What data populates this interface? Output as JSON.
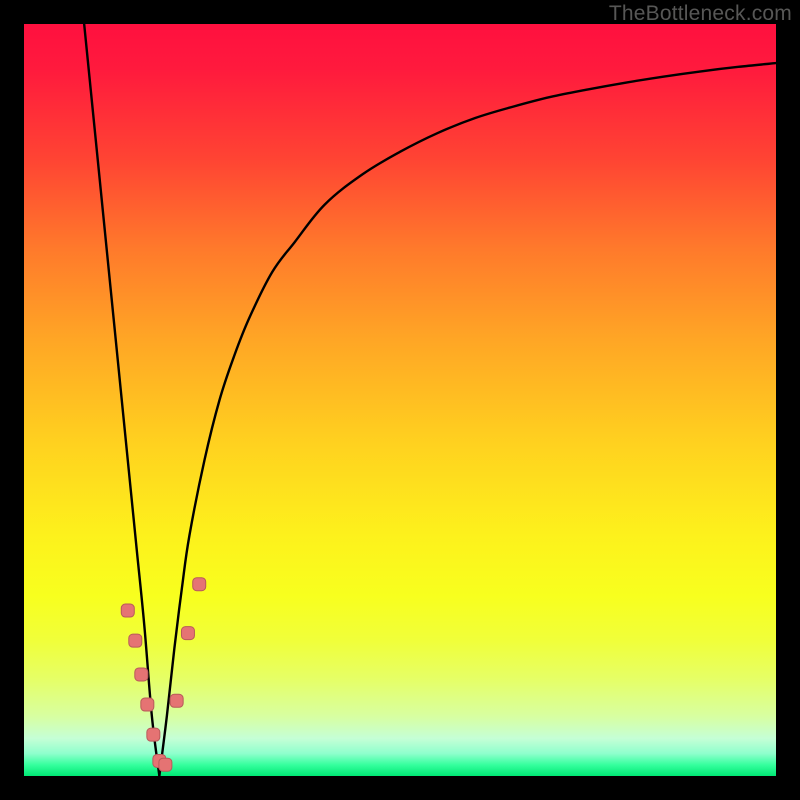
{
  "watermark": "TheBottleneck.com",
  "colors": {
    "frame": "#000000",
    "curve_stroke": "#000000",
    "marker_fill": "#e57373",
    "marker_stroke": "#b85a5a"
  },
  "chart_data": {
    "type": "line",
    "title": "",
    "xlabel": "",
    "ylabel": "",
    "xlim": [
      0,
      100
    ],
    "ylim": [
      0,
      100
    ],
    "grid": false,
    "note": "Bottleneck-style V curve. x is a normalized balance parameter (0–100) with the optimum near x≈18 where y≈0. y rises steeply on both sides; the right branch asymptotes near y≈95 as x→100. Axes are unlabeled in the source image; values are read off the plot geometry.",
    "series": [
      {
        "name": "left-branch",
        "x": [
          8,
          9,
          10,
          11,
          12,
          13,
          14,
          15,
          16,
          17,
          18
        ],
        "y": [
          100,
          90,
          80,
          70,
          60,
          50,
          40,
          30,
          20,
          8,
          0
        ]
      },
      {
        "name": "right-branch",
        "x": [
          18,
          19,
          20,
          21,
          22,
          24,
          26,
          28,
          30,
          33,
          36,
          40,
          45,
          50,
          55,
          60,
          65,
          70,
          75,
          80,
          85,
          90,
          95,
          100
        ],
        "y": [
          0,
          8,
          17,
          25,
          32,
          42,
          50,
          56,
          61,
          67,
          71,
          76,
          80,
          83,
          85.5,
          87.5,
          89,
          90.3,
          91.3,
          92.2,
          93,
          93.7,
          94.3,
          94.8
        ]
      }
    ],
    "markers": {
      "name": "highlight-points",
      "x": [
        13.8,
        14.8,
        15.6,
        16.4,
        17.2,
        18.0,
        18.8,
        20.3,
        21.8,
        23.3
      ],
      "y": [
        22.0,
        18.0,
        13.5,
        9.5,
        5.5,
        2.0,
        1.5,
        10.0,
        19.0,
        25.5
      ]
    }
  }
}
